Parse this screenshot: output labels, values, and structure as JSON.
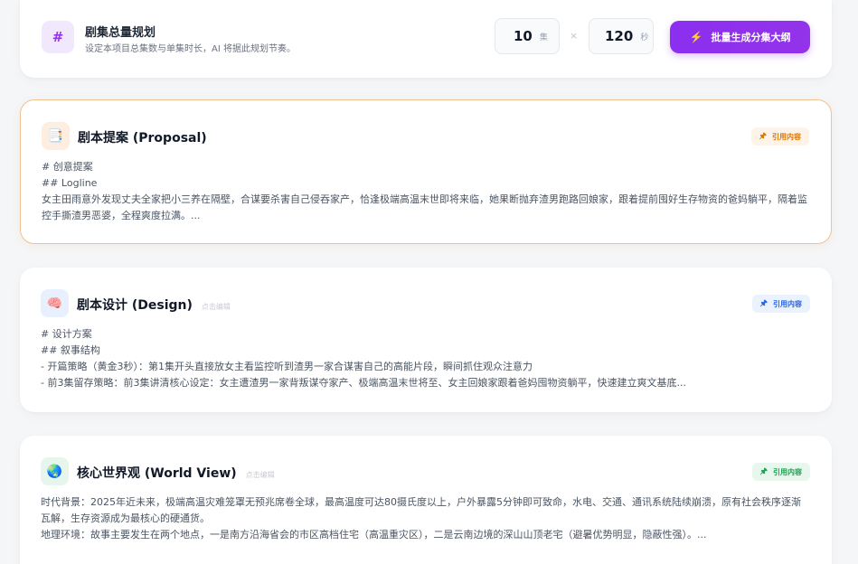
{
  "plan": {
    "icon": "hash-icon",
    "icon_glyph": "#",
    "title": "剧集总量规划",
    "subtitle": "设定本项目总集数与单集时长，AI 将据此规划节奏。",
    "episodes": "10",
    "episodes_unit": "集",
    "times": "×",
    "seconds": "120",
    "seconds_unit": "秒",
    "button_label": "批量生成分集大纲",
    "accent": "#9333ea"
  },
  "sections": [
    {
      "title": "剧本提案 (Proposal)",
      "hint": "",
      "icon": "document-icon",
      "icon_glyph": "📑",
      "badge": "引用内容",
      "lines": [
        "# 创意提案",
        "## Logline",
        "女主田雨意外发现丈夫全家把小三养在隔壁，合谋要杀害自己侵吞家产，恰逢极端高温末世即将来临，她果断抛弃渣男跑路回娘家，跟着提前囤好生存物资的爸妈躺平，隔着监控手撕渣男恶婆，全程爽度拉满。..."
      ]
    },
    {
      "title": "剧本设计 (Design)",
      "hint": "点击编辑",
      "icon": "brain-icon",
      "icon_glyph": "🧠",
      "badge": "引用内容",
      "lines": [
        "# 设计方案",
        "## 叙事结构",
        "- 开篇策略（黄金3秒）：第1集开头直接放女主看监控听到渣男一家合谋害自己的高能片段，瞬间抓住观众注意力",
        "- 前3集留存策略：前3集讲清核心设定：女主遭渣男一家背叛谋夺家产、极端高温末世将至、女主回娘家跟着爸妈囤物资躺平，快速建立爽文基底..."
      ]
    },
    {
      "title": "核心世界观 (World View)",
      "hint": "点击编辑",
      "icon": "globe-icon",
      "icon_glyph": "🌏",
      "badge": "引用内容",
      "lines": [
        "时代背景：2025年近未来，极端高温灾难笼罩无预兆席卷全球，最高温度可达80摄氏度以上，户外暴露5分钟即可致命，水电、交通、通讯系统陆续崩溃，原有社会秩序逐渐瓦解，生存资源成为最核心的硬通货。",
        "地理环境：故事主要发生在两个地点，一是南方沿海省会的市区高档住宅（高温重灾区），二是云南边境的深山山顶老宅（避暑优势明显，隐蔽性强）。..."
      ]
    }
  ],
  "colors": {
    "proposal_badge_bg": "#fdf3e7",
    "proposal_badge_fg": "#d97706",
    "design_badge_bg": "#eaf2fd",
    "design_badge_fg": "#2563eb",
    "world_badge_bg": "#e8f7ee",
    "world_badge_fg": "#16a34a"
  }
}
